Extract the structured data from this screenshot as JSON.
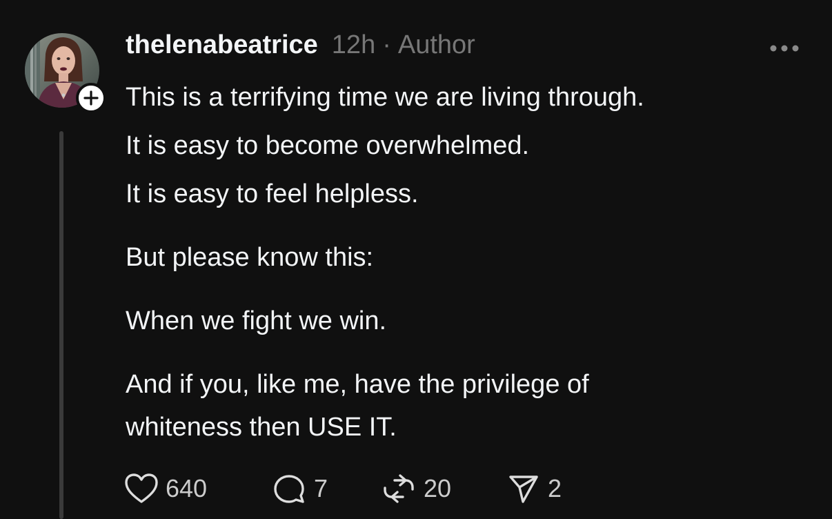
{
  "post": {
    "username": "thelenabeatrice",
    "time": "12h",
    "separator": "·",
    "role_tag": "Author",
    "lines": [
      "This is a terrifying time we are living through.",
      "It is easy to become overwhelmed.",
      "It is easy to feel helpless.",
      "But please know this:",
      "When we fight we win.",
      "And if you, like me, have the privilege of whiteness then USE IT."
    ],
    "actions": {
      "likes": "640",
      "replies": "7",
      "reposts": "20",
      "shares": "2"
    }
  },
  "icons": {
    "follow": "plus-icon",
    "more": "ellipsis-icon",
    "like": "heart-icon",
    "reply": "comment-bubble-icon",
    "repost": "repost-arrows-icon",
    "share": "send-paper-plane-icon"
  },
  "colors": {
    "background": "#101010",
    "text_primary": "#f3f5f7",
    "text_secondary": "#777777",
    "thread_line": "#3a3a3a"
  }
}
